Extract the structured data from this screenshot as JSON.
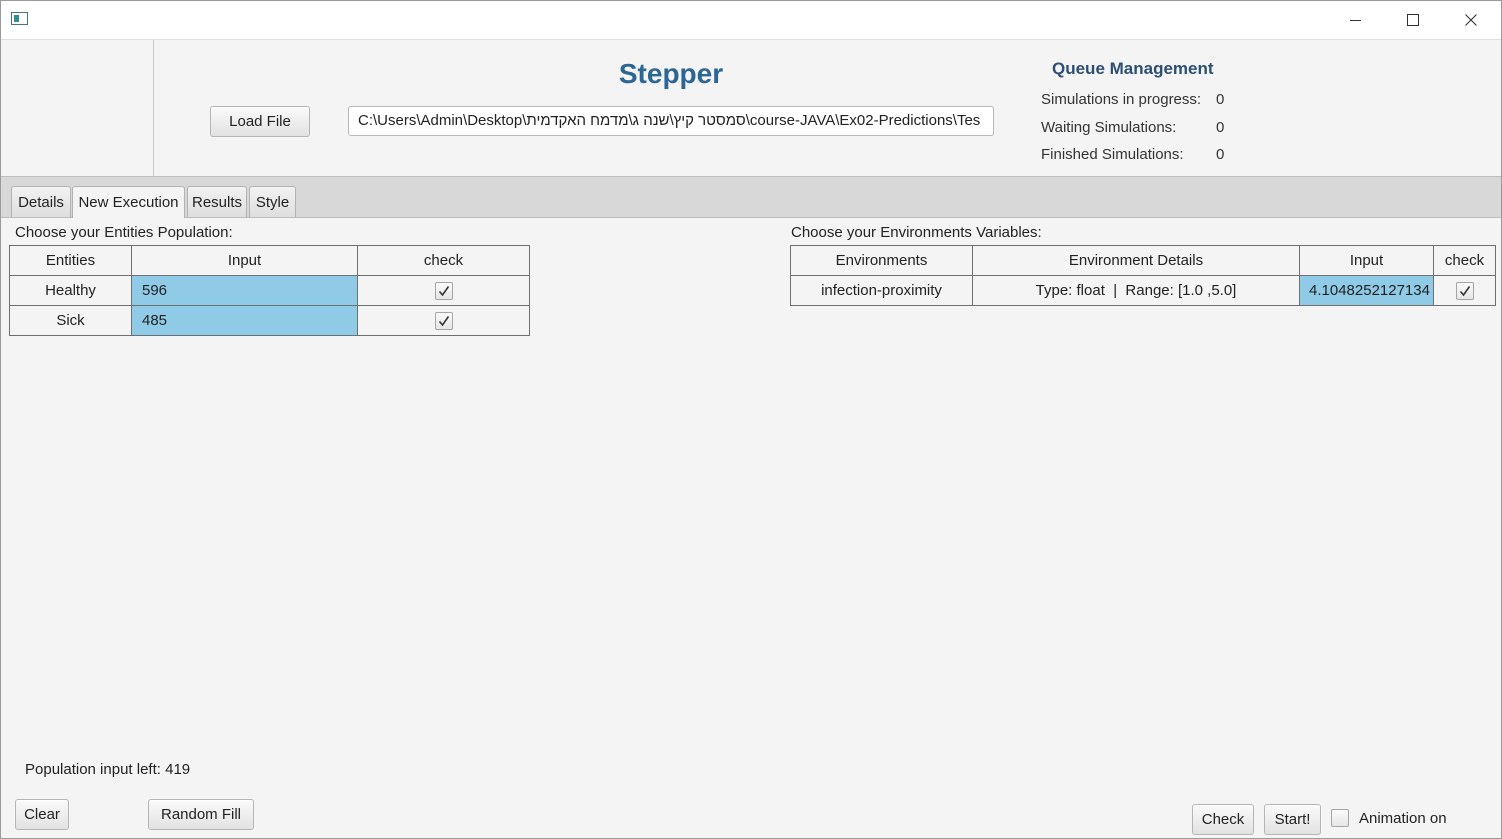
{
  "window": {
    "icon": "app-window-icon",
    "controls": [
      "minimize-icon",
      "maximize-icon",
      "close-icon"
    ]
  },
  "header": {
    "title": "Stepper",
    "load_file_label": "Load File",
    "file_path": "C:\\Users\\Admin\\Desktop\\סמסטר קיץ\\שנה ג\\מדמח האקדמית\\course-JAVA\\Ex02-Predictions\\Tes"
  },
  "queue": {
    "title": "Queue Management",
    "in_progress_label": "Simulations in progress:",
    "in_progress_value": "0",
    "waiting_label": "Waiting Simulations:",
    "waiting_value": "0",
    "finished_label": "Finished Simulations:",
    "finished_value": "0"
  },
  "tabs": [
    {
      "label": "Details",
      "active": false
    },
    {
      "label": "New Execution",
      "active": true
    },
    {
      "label": "Results",
      "active": false
    },
    {
      "label": "Style",
      "active": false
    }
  ],
  "entities": {
    "section_label": "Choose your Entities Population:",
    "columns": [
      "Entities",
      "Input",
      "check"
    ],
    "rows": [
      {
        "name": "Healthy",
        "input": "596",
        "checked": true
      },
      {
        "name": "Sick",
        "input": "485",
        "checked": true
      }
    ]
  },
  "environments": {
    "section_label": "Choose your Environments Variables:",
    "columns": [
      "Environments",
      "Environment Details",
      "Input",
      "check"
    ],
    "rows": [
      {
        "name": "infection-proximity",
        "details": "Type: float  |  Range: [1.0 ,5.0]",
        "input": "4.1048252127134",
        "checked": true
      }
    ]
  },
  "footer": {
    "population_left": "Population input left: 419",
    "clear_label": "Clear",
    "random_fill_label": "Random Fill",
    "check_label": "Check",
    "start_label": "Start!",
    "animation_label": "Animation on",
    "animation_checked": false
  }
}
